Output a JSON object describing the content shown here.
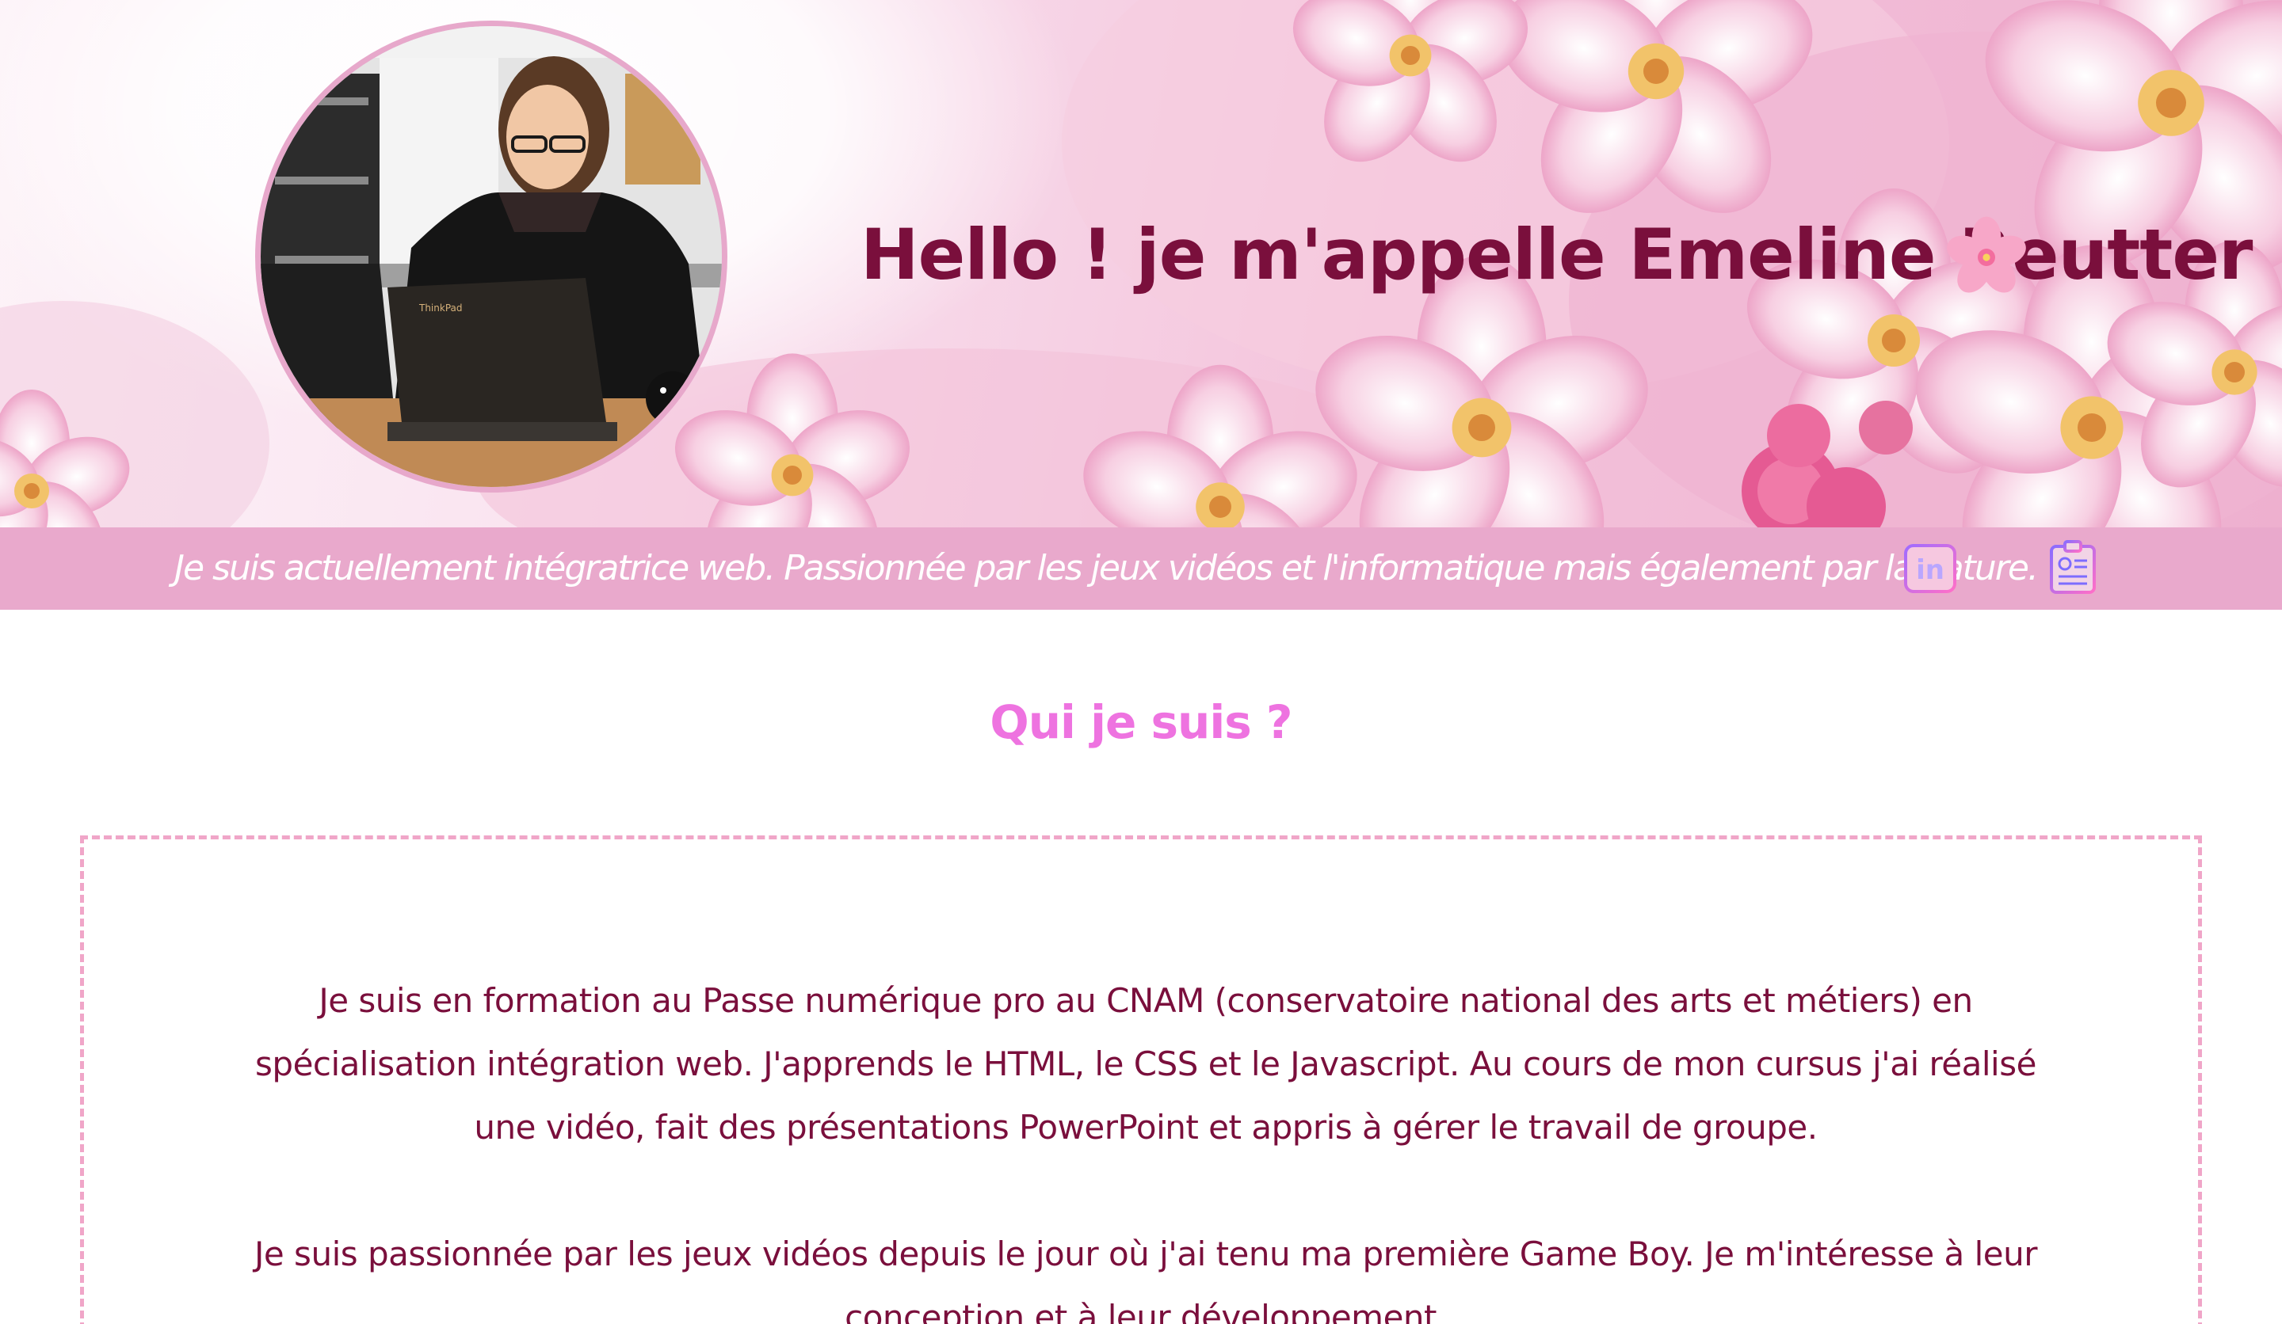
{
  "hero": {
    "title": "Hello ! je m'appelle Emeline Reutter",
    "title_emoji": "cherry-blossom-icon",
    "avatar_alt": "avatar-photo"
  },
  "band": {
    "tagline": "Je suis actuellement intégratrice web. Passionnée par les jeux vidéos et l'informatique mais également par la nature.",
    "links": [
      {
        "name": "linkedin-icon",
        "icon": "in"
      },
      {
        "name": "cv-icon"
      }
    ]
  },
  "about": {
    "title": "Qui je suis ?",
    "paragraphs": [
      "Je suis en formation au Passe numérique pro au CNAM (conservatoire national des arts et métiers) en spécialisation intégration web. J'apprends le HTML, le CSS et le Javascript. Au cours de mon cursus j'ai réalisé une vidéo, fait des présentations PowerPoint et appris à gérer le travail de groupe.",
      "Je suis passionnée par les jeux vidéos depuis le jour où j'ai tenu ma première Game Boy. Je m'intéresse à leur conception et à leur développement."
    ]
  },
  "colors": {
    "title": "#7a0f3c",
    "accent_pink": "#e9a9cc",
    "section_title": "#ee73e0",
    "border": "#f0a6c8"
  }
}
